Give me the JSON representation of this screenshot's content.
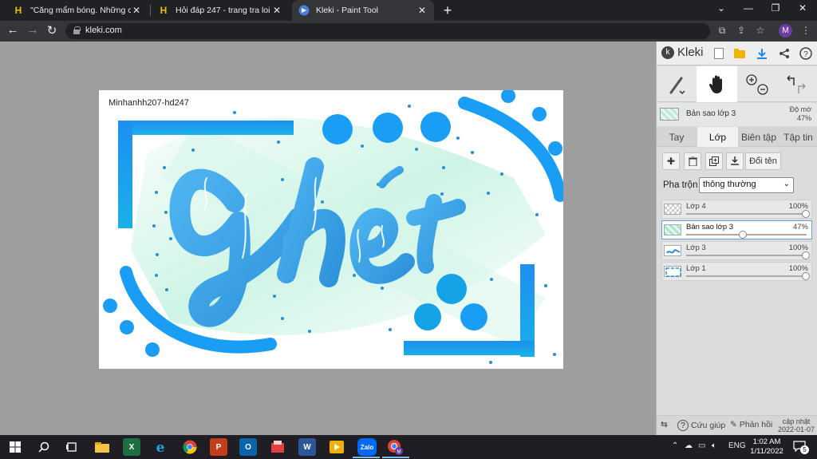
{
  "browser": {
    "tabs": [
      {
        "title": "\"Căng mẩm bóng. Những cái vu",
        "favicon": "H",
        "active": false
      },
      {
        "title": "Hỏi đáp 247 - trang tra loi",
        "favicon": "H",
        "active": false
      },
      {
        "title": "Kleki - Paint Tool",
        "favicon": "kleki",
        "active": true
      }
    ],
    "new_tab": "+",
    "url": "kleki.com",
    "profile_initial": "M"
  },
  "canvas": {
    "signature": "Minhanhh207-hd247",
    "artwork_text": "Ghét"
  },
  "panel": {
    "logo": "Kleki",
    "current_layer": {
      "name": "Bản sao lớp 3",
      "opacity_label": "Độ mờ",
      "opacity": "47%"
    },
    "tabs": [
      "Tay",
      "Lớp",
      "Biên tập",
      "Tập tin"
    ],
    "active_tab": "Lớp",
    "rename_label": "Đổi tên",
    "blend_label": "Pha trộn",
    "blend_value": "thông thường",
    "layers": [
      {
        "name": "Lớp 4",
        "opacity": "100%",
        "opacity_value": 1.0,
        "active": false
      },
      {
        "name": "Bản sao lớp 3",
        "opacity": "47%",
        "opacity_value": 0.47,
        "active": true
      },
      {
        "name": "Lớp 3",
        "opacity": "100%",
        "opacity_value": 1.0,
        "active": false
      },
      {
        "name": "Lớp 1",
        "opacity": "100%",
        "opacity_value": 1.0,
        "active": false
      }
    ],
    "footer": {
      "help": "Cứu giúp",
      "feedback": "Phản hồi",
      "update_label": "cập nhật",
      "update_date": "2022-01-07"
    }
  },
  "taskbar": {
    "language": "ENG",
    "time": "1:02 AM",
    "date": "1/11/2022",
    "notifications": "5",
    "zalo_label": "Zalo"
  },
  "colors": {
    "accent_blue": "#1a9ef5",
    "art_blue": "#3aa7e6",
    "mint": "#bfeedd",
    "chrome_bg": "#202124",
    "panel_bg": "#dcdcdc"
  }
}
